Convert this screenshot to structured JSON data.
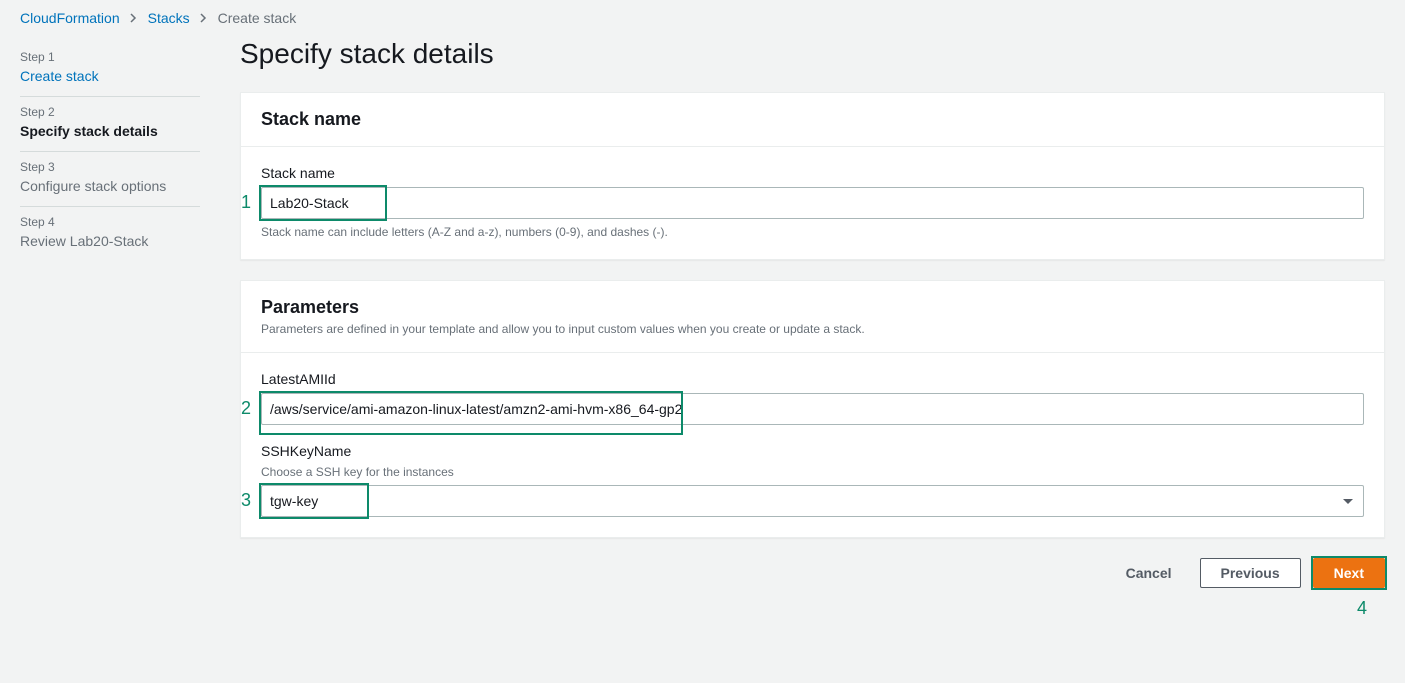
{
  "breadcrumb": {
    "items": [
      {
        "label": "CloudFormation",
        "link": true
      },
      {
        "label": "Stacks",
        "link": true
      },
      {
        "label": "Create stack",
        "link": false
      }
    ]
  },
  "wizard": {
    "steps": [
      {
        "num": "Step 1",
        "title": "Create stack",
        "state": "done"
      },
      {
        "num": "Step 2",
        "title": "Specify stack details",
        "state": "active"
      },
      {
        "num": "Step 3",
        "title": "Configure stack options",
        "state": "pending"
      },
      {
        "num": "Step 4",
        "title": "Review Lab20-Stack",
        "state": "pending"
      }
    ]
  },
  "page": {
    "title": "Specify stack details"
  },
  "stackNamePanel": {
    "header": "Stack name",
    "fieldLabel": "Stack name",
    "value": "Lab20-Stack",
    "hint": "Stack name can include letters (A-Z and a-z), numbers (0-9), and dashes (-)."
  },
  "parametersPanel": {
    "header": "Parameters",
    "description": "Parameters are defined in your template and allow you to input custom values when you create or update a stack.",
    "fields": {
      "latestAmi": {
        "label": "LatestAMIId",
        "value": "/aws/service/ami-amazon-linux-latest/amzn2-ami-hvm-x86_64-gp2"
      },
      "sshKey": {
        "label": "SSHKeyName",
        "hint": "Choose a SSH key for the instances",
        "value": "tgw-key"
      }
    }
  },
  "footer": {
    "cancel": "Cancel",
    "previous": "Previous",
    "next": "Next"
  },
  "annotations": {
    "n1": "1",
    "n2": "2",
    "n3": "3",
    "n4": "4"
  }
}
